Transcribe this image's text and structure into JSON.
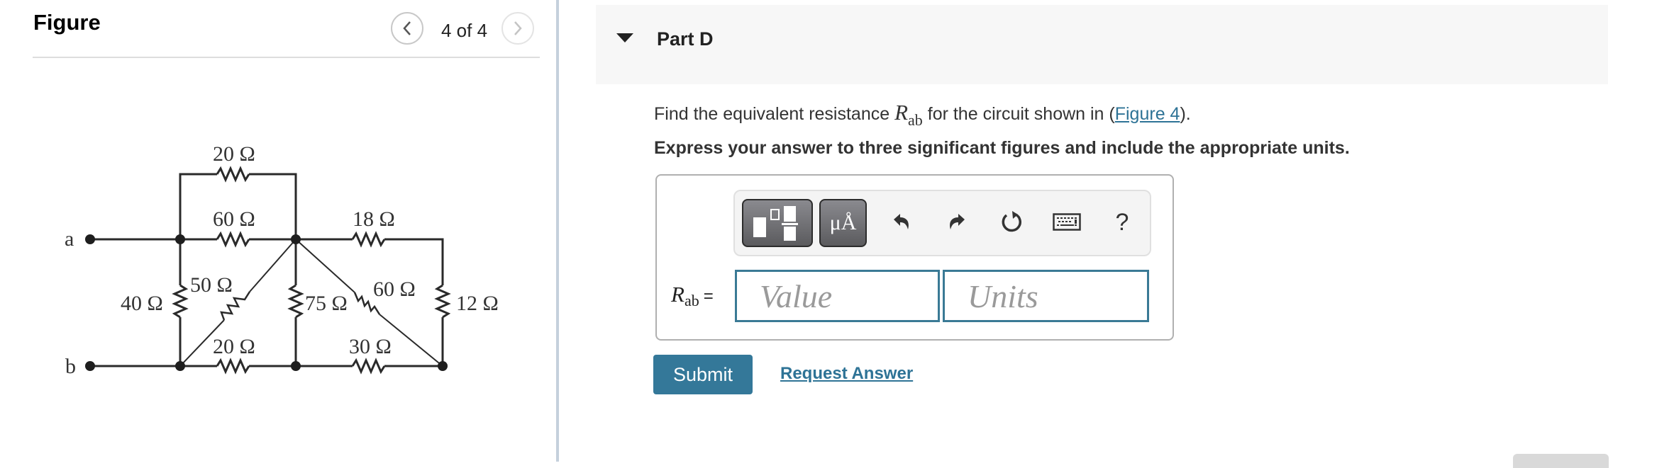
{
  "figure_panel": {
    "title": "Figure",
    "pager": {
      "current": 4,
      "total": 4,
      "text": "4 of 4",
      "prev_icon": "chevron-left-icon",
      "next_icon": "chevron-right-icon"
    },
    "circuit": {
      "terminals": [
        "a",
        "b"
      ],
      "resistors": [
        {
          "id": "r-top-20",
          "label": "20 Ω"
        },
        {
          "id": "r-60-ab",
          "label": "60 Ω"
        },
        {
          "id": "r-18",
          "label": "18 Ω"
        },
        {
          "id": "r-40",
          "label": "40 Ω"
        },
        {
          "id": "r-50",
          "label": "50 Ω"
        },
        {
          "id": "r-75",
          "label": "75 Ω"
        },
        {
          "id": "r-60-diag",
          "label": "60 Ω"
        },
        {
          "id": "r-12",
          "label": "12 Ω"
        },
        {
          "id": "r-bot-20",
          "label": "20 Ω"
        },
        {
          "id": "r-30",
          "label": "30 Ω"
        }
      ]
    }
  },
  "part": {
    "title": "Part D",
    "question_prefix": "Find the equivalent resistance ",
    "symbol": "R",
    "symbol_sub": "ab",
    "question_middle": " for the circuit shown in (",
    "figure_link": "Figure 4",
    "question_suffix": ").",
    "instructions": "Express your answer to three significant figures and include the appropriate units."
  },
  "answer": {
    "label_symbol": "R",
    "label_sub": "ab",
    "label_eq": "=",
    "value_placeholder": "Value",
    "units_placeholder": "Units",
    "value": "",
    "units": "",
    "toolbar": {
      "units_button": "μÅ",
      "help": "?",
      "icons": [
        "templates-icon",
        "units-icon",
        "undo-icon",
        "redo-icon",
        "reset-icon",
        "keyboard-icon",
        "help-icon"
      ]
    }
  },
  "actions": {
    "submit": "Submit",
    "request_answer": "Request Answer"
  },
  "colors": {
    "accent": "#347899",
    "link": "#2e7396",
    "input_border": "#3a7a95",
    "header_bg": "#f7f7f7"
  }
}
